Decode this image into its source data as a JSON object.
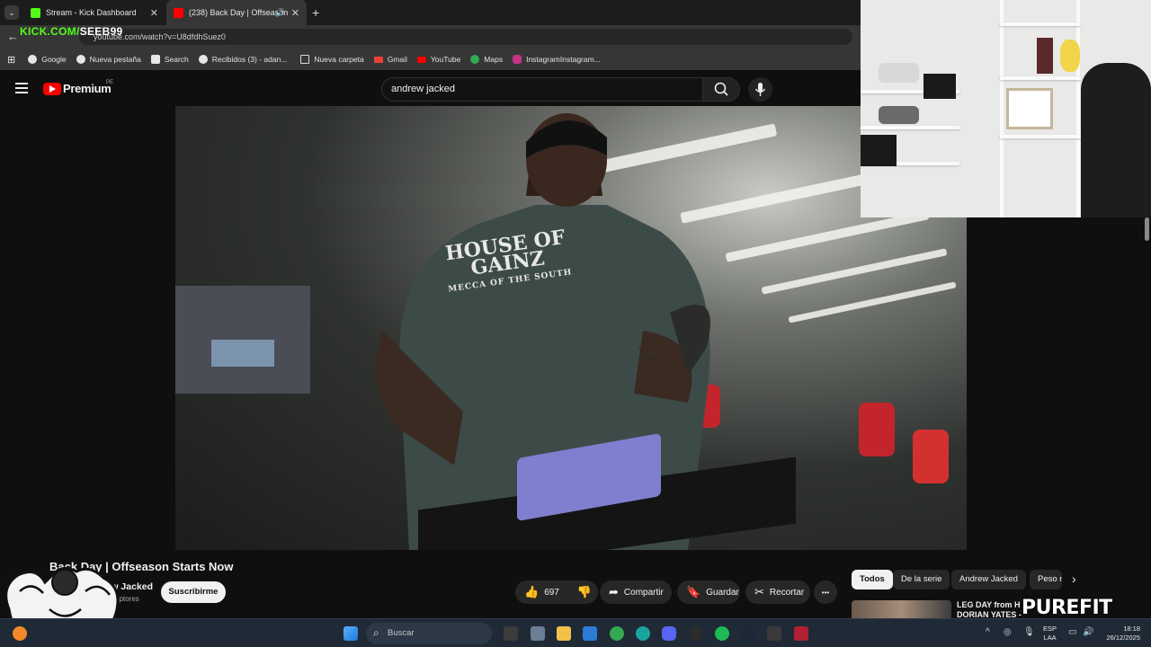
{
  "browser": {
    "tabs": [
      {
        "title": "Stream - Kick Dashboard",
        "close": "✕"
      },
      {
        "title": "(238) Back Day | Offseason",
        "close": "✕"
      }
    ],
    "new_tab": "+",
    "tab_menu": "⌄",
    "back": "←",
    "url": "youtube.com/watch?v=U8dfdhSuez0",
    "bookmarks_icon": "⊞",
    "bookmarks": [
      {
        "label": "Google",
        "color": "#e6e6e6"
      },
      {
        "label": "Nueva pestaña",
        "color": "#e6e6e6"
      },
      {
        "label": "Search",
        "color": "#e6e6e6"
      },
      {
        "label": "Recibidos (3) - adan...",
        "color": "#e6e6e6"
      },
      {
        "label": "Nueva carpeta",
        "color": "#d8b04a"
      },
      {
        "label": "Gmail",
        "color": "#ea4335"
      },
      {
        "label": "YouTube",
        "color": "#ff0000"
      },
      {
        "label": "Maps",
        "color": "#34a853"
      },
      {
        "label": "InstagramInstagram...",
        "color": "#c13584"
      }
    ]
  },
  "overlay": {
    "kick_prefix": "KICK.COM/",
    "kick_channel": "SEEB99",
    "brand_text": "PUREFIT"
  },
  "youtube": {
    "logo_text": "Premium",
    "region": "PE",
    "search_query": "andrew jacked",
    "video": {
      "title": "Back Day | Offseason Starts Now",
      "shirt_text_1": "HOUSE OF",
      "shirt_text_2": "GAINZ",
      "shirt_text_3": "MECCA OF THE SOUTH"
    },
    "channel": {
      "name": "Andrew Jacked",
      "subscribers": "70 K suscriptores",
      "subscribe_label": "Suscribirme"
    },
    "actions": {
      "likes": "697",
      "share": "Compartir",
      "save": "Guardar",
      "clip": "Recortar",
      "more": "•••"
    },
    "chips": [
      "Todos",
      "De la serie",
      "Andrew Jacked",
      "Peso m"
    ],
    "related": {
      "title_line1": "LEG DAY from H",
      "title_line2": "DORIAN YATES -"
    }
  },
  "taskbar": {
    "search_placeholder": "Buscar",
    "lang_1": "ESP",
    "lang_2": "LAA",
    "time": "18:18",
    "date": "26/12/2025"
  },
  "colors": {
    "kick_green": "#53fc18",
    "youtube_red": "#ff0000",
    "background": "#0f0f0f"
  }
}
